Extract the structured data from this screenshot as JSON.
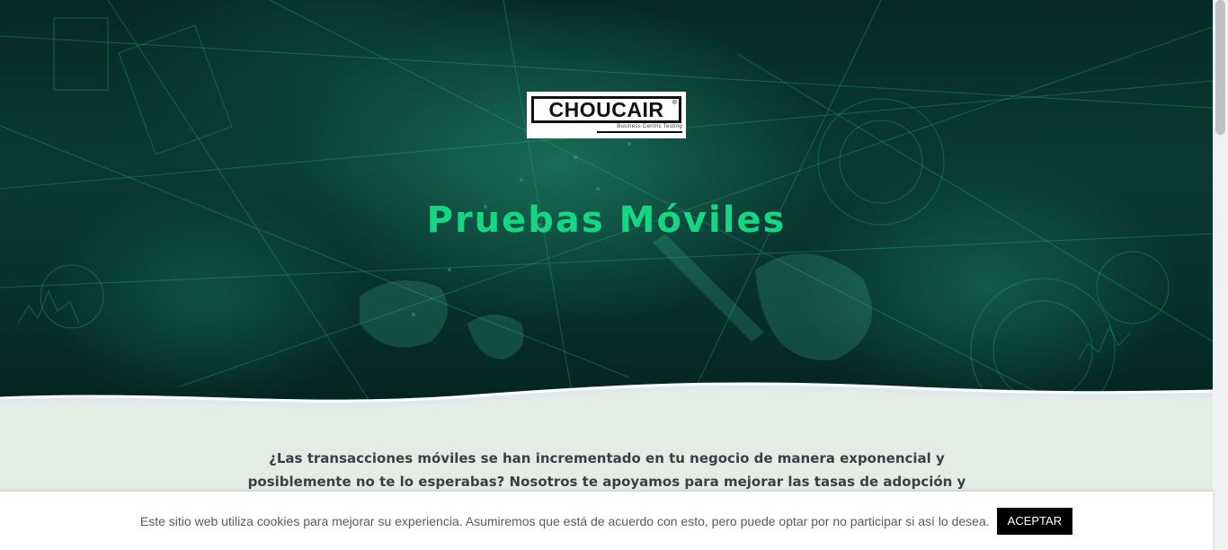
{
  "brand": {
    "name": "CHOUCAIR",
    "tagline": "Business Centric Testing",
    "registered_mark": "®"
  },
  "hero": {
    "title": "Pruebas Móviles"
  },
  "intro": {
    "text": "¿Las transacciones móviles se han incrementado en tu negocio de manera exponencial y posiblemente no te lo esperabas? Nosotros te apoyamos para mejorar las tasas de adopción y que tus clientes tengan una"
  },
  "cookie_notice": {
    "text": "Este sitio web utiliza cookies para mejorar su experiencia. Asumiremos que está de acuerdo con esto, pero puede optar por no participar si así lo desea.",
    "accept_label": "ACEPTAR"
  },
  "colors": {
    "accent": "#15d683",
    "hero_dark": "#062a26",
    "content_bg": "#e4ece6",
    "button_bg": "#000000"
  }
}
